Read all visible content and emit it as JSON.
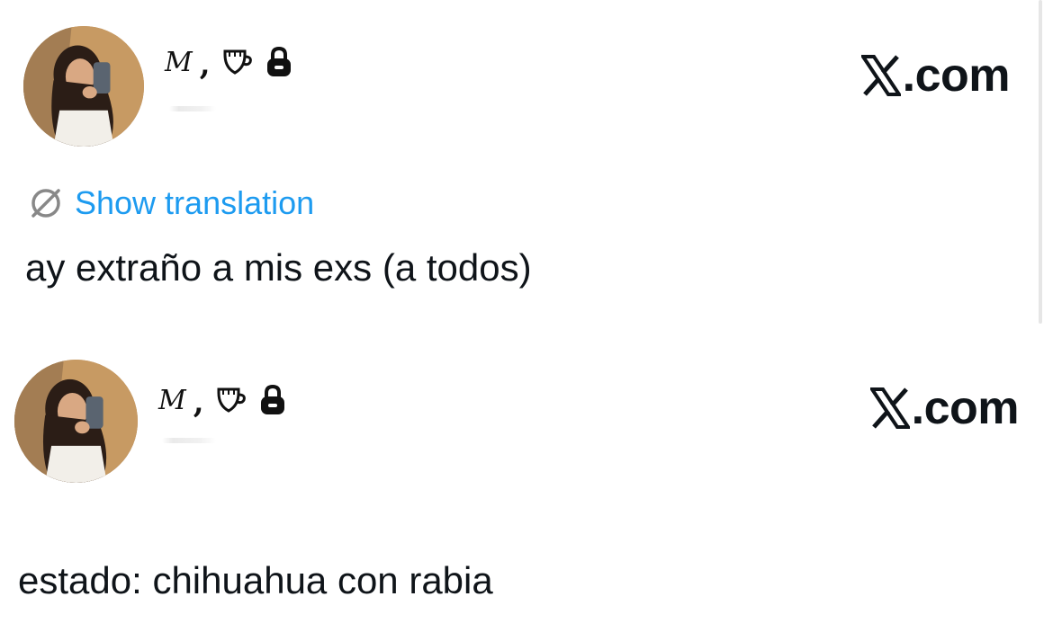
{
  "posts": [
    {
      "display_name_initial": "M",
      "display_name_separator": ",",
      "name_icons": [
        "mug-icon",
        "lock-icon"
      ],
      "site_label": ".com",
      "translate_label": "Show translation",
      "text": "ay extraño a mis exs (a todos)"
    },
    {
      "display_name_initial": "M",
      "display_name_separator": ",",
      "name_icons": [
        "mug-icon",
        "lock-icon"
      ],
      "site_label": ".com",
      "text": "estado: chihuahua con rabia"
    }
  ],
  "colors": {
    "text": "#0f1419",
    "link": "#1d9bf0",
    "background": "#ffffff"
  }
}
